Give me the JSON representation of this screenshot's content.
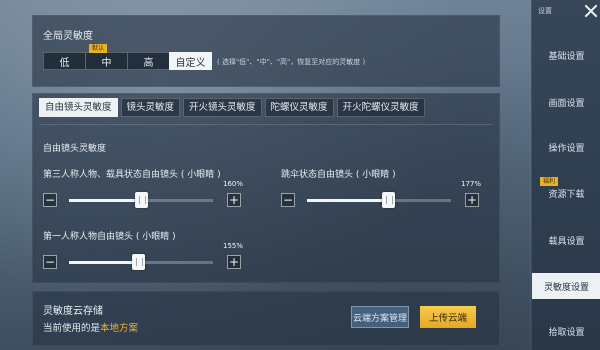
{
  "sensitivity_panel": {
    "title": "全局灵敏度",
    "options": [
      "低",
      "中",
      "高",
      "自定义"
    ],
    "default_badge": "默认",
    "selected": "自定义",
    "hint": "( 选择\"低\"、\"中\"、\"高\"，恢复至对应的灵敏度 )"
  },
  "tabs": [
    "自由镜头灵敏度",
    "镜头灵敏度",
    "开火镜头灵敏度",
    "陀螺仪灵敏度",
    "开火陀螺仪灵敏度"
  ],
  "active_tab": "自由镜头灵敏度",
  "free_camera": {
    "section_title": "自由镜头灵敏度",
    "sliders": [
      {
        "label": "第三人称人物、载具状态自由镜头 ( 小眼睛 )",
        "value_text": "160%",
        "value": 160,
        "fill": 0.5
      },
      {
        "label": "跳伞状态自由镜头 ( 小眼睛 )",
        "value_text": "177%",
        "value": 177,
        "fill": 0.56
      },
      {
        "label": "第一人称人物自由镜头 ( 小眼睛 )",
        "value_text": "155%",
        "value": 155,
        "fill": 0.48
      }
    ],
    "minus_glyph": "−",
    "plus_glyph": "+"
  },
  "cloud": {
    "title": "灵敏度云存储",
    "current_prefix": "当前使用的是",
    "current_value": "本地方案",
    "manage_button": "云端方案管理",
    "upload_button": "上传云端"
  },
  "sidebar": {
    "header": "设置",
    "items": [
      "基础设置",
      "画面设置",
      "操作设置",
      "资源下载",
      "载具设置",
      "灵敏度设置",
      "拾取设置"
    ],
    "active": "灵敏度设置",
    "badge": "福利",
    "badge_item": "资源下载"
  },
  "colors": {
    "accent": "#f0b232",
    "active_bg": "#eef1f4",
    "panel_bg": "#263444"
  }
}
